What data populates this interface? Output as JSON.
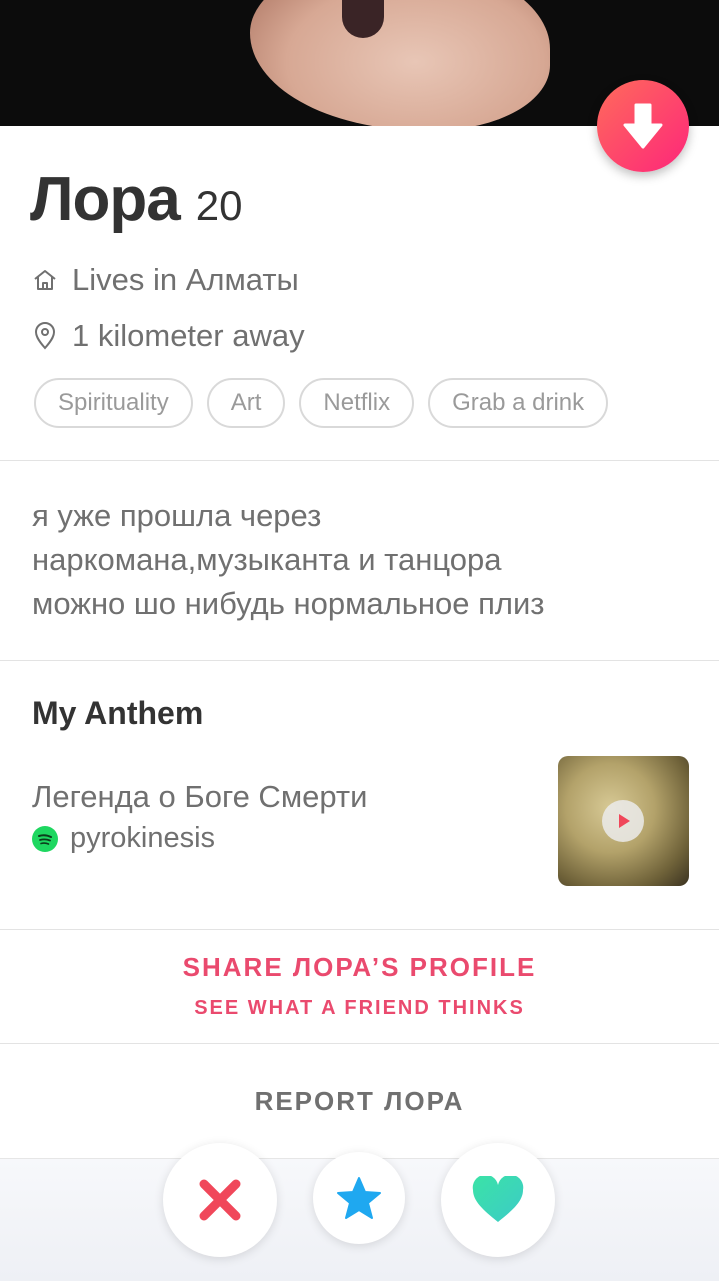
{
  "profile": {
    "name": "Лора",
    "age": "20",
    "lives_in": "Lives in Алматы",
    "distance": "1 kilometer away",
    "interests": [
      "Spirituality",
      "Art",
      "Netflix",
      "Grab a drink"
    ],
    "bio_lines": [
      "я уже прошла через",
      "наркомана,музыканта и танцора",
      "можно шо нибудь нормальное плиз"
    ]
  },
  "anthem": {
    "heading": "My Anthem",
    "song": "Легенда о Боге Смерти",
    "artist": "pyrokinesis"
  },
  "share": {
    "title": "SHARE ЛОРА’S PROFILE",
    "subtitle": "SEE WHAT A FRIEND THINKS"
  },
  "report": {
    "label": "REPORT ЛОРА"
  },
  "icons": {
    "collapse": "arrow-down-icon",
    "home": "home-icon",
    "location": "location-pin-icon",
    "spotify": "spotify-icon",
    "play": "play-icon",
    "nope": "x-icon",
    "super_like": "star-icon",
    "like": "heart-icon"
  },
  "colors": {
    "brand_gradient_start": "#ff6b5b",
    "brand_gradient_end": "#fd267a",
    "share_text": "#ea4a6e",
    "nope": "#f0475a",
    "super_like": "#1fa8f0",
    "like": "#45e0b4",
    "spotify": "#1ed760"
  }
}
